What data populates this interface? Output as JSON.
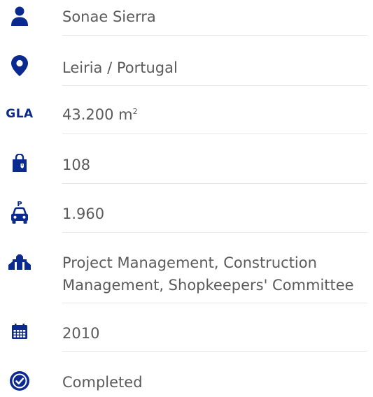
{
  "rows": [
    {
      "icon": "person-icon",
      "text": "Sonae Sierra"
    },
    {
      "icon": "location-pin-icon",
      "text": "Leiria / Portugal"
    },
    {
      "icon": "gla-icon",
      "icon_label": "GLA",
      "text": "43.200 m",
      "text_sup": "2"
    },
    {
      "icon": "shopping-bag-icon",
      "text": "108"
    },
    {
      "icon": "parking-car-icon",
      "icon_label": "P",
      "text": "1.960"
    },
    {
      "icon": "building-icon",
      "text": "Project Management, Construction Management, Shopkeepers' Committee"
    },
    {
      "icon": "calendar-icon",
      "text": "2010"
    },
    {
      "icon": "check-circle-icon",
      "text": "Completed"
    }
  ],
  "colors": {
    "icon": "#0a2a8f",
    "text": "#5b5b5b",
    "divider": "#e7e7e7"
  }
}
